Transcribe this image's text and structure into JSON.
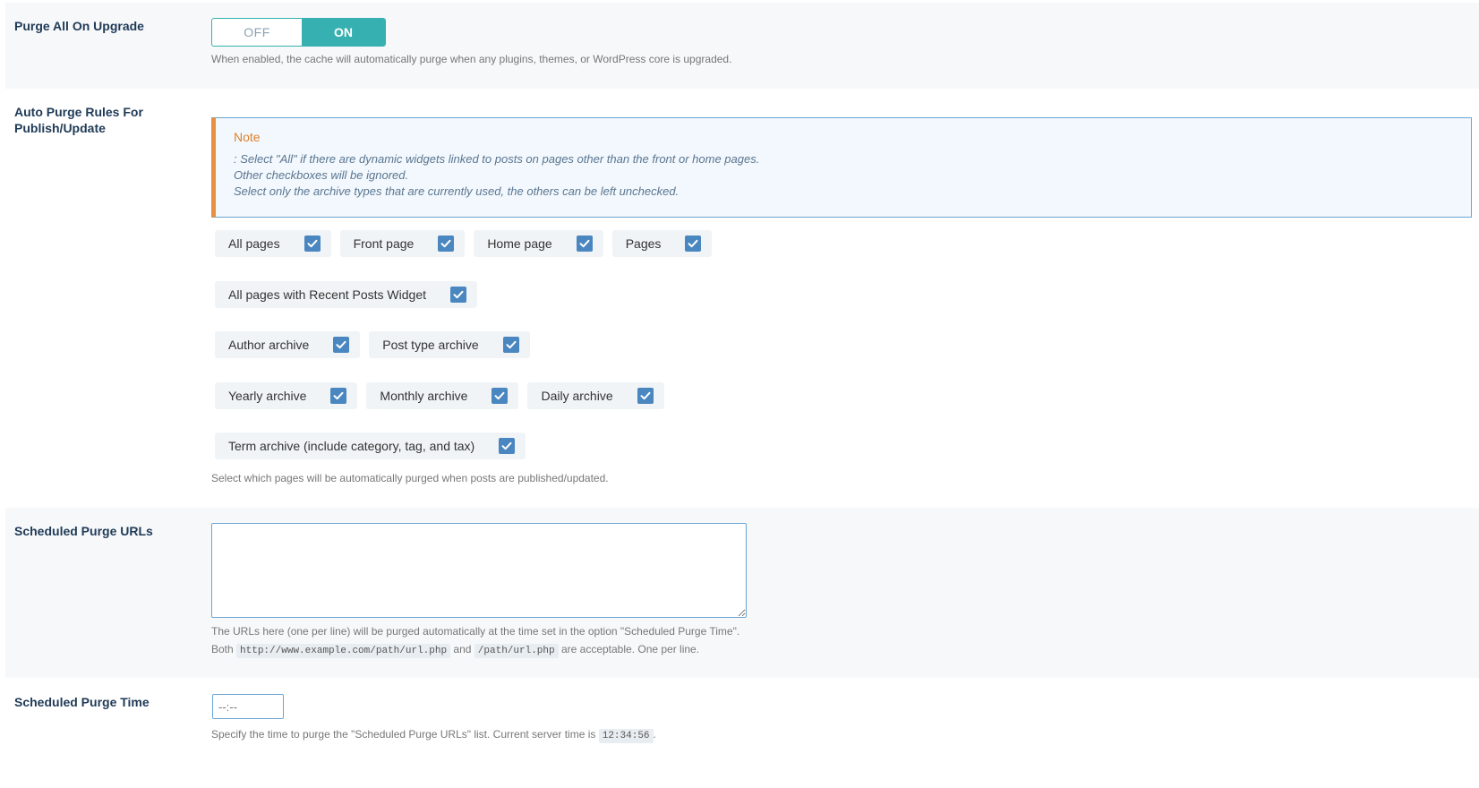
{
  "purge_upgrade": {
    "label": "Purge All On Upgrade",
    "toggle_off": "OFF",
    "toggle_on": "ON",
    "state": "ON",
    "description": "When enabled, the cache will automatically purge when any plugins, themes, or WordPress core is upgraded."
  },
  "auto_purge": {
    "label": "Auto Purge Rules For Publish/Update",
    "note_title": "Note",
    "note_lines": [
      ": Select \"All\" if there are dynamic widgets linked to posts on pages other than the front or home pages.",
      "Other checkboxes will be ignored.",
      "Select only the archive types that are currently used, the others can be left unchecked."
    ],
    "checkbox_rows": [
      [
        {
          "label": "All pages",
          "checked": true
        },
        {
          "label": "Front page",
          "checked": true
        },
        {
          "label": "Home page",
          "checked": true
        },
        {
          "label": "Pages",
          "checked": true
        }
      ],
      [
        {
          "label": "All pages with Recent Posts Widget",
          "checked": true
        }
      ],
      [
        {
          "label": "Author archive",
          "checked": true
        },
        {
          "label": "Post type archive",
          "checked": true
        }
      ],
      [
        {
          "label": "Yearly archive",
          "checked": true
        },
        {
          "label": "Monthly archive",
          "checked": true
        },
        {
          "label": "Daily archive",
          "checked": true
        }
      ],
      [
        {
          "label": "Term archive (include category, tag, and tax)",
          "checked": true
        }
      ]
    ],
    "description": "Select which pages will be automatically purged when posts are published/updated."
  },
  "scheduled_urls": {
    "label": "Scheduled Purge URLs",
    "value": "",
    "desc_line1": "The URLs here (one per line) will be purged automatically at the time set in the option \"Scheduled Purge Time\".",
    "desc_both": "Both",
    "example_full": "http://www.example.com/path/url.php",
    "desc_and": "and",
    "example_path": "/path/url.php",
    "desc_end": "are acceptable. One per line."
  },
  "scheduled_time": {
    "label": "Scheduled Purge Time",
    "placeholder": "--:--",
    "description": "Specify the time to purge the \"Scheduled Purge URLs\" list. Current server time is",
    "server_time": "12:34:56",
    "desc_end": "."
  },
  "colors": {
    "accent_teal": "#36b0b0",
    "checkbox_blue": "#4a86c0",
    "note_orange": "#e8903d",
    "label_navy": "#1f3a56"
  }
}
